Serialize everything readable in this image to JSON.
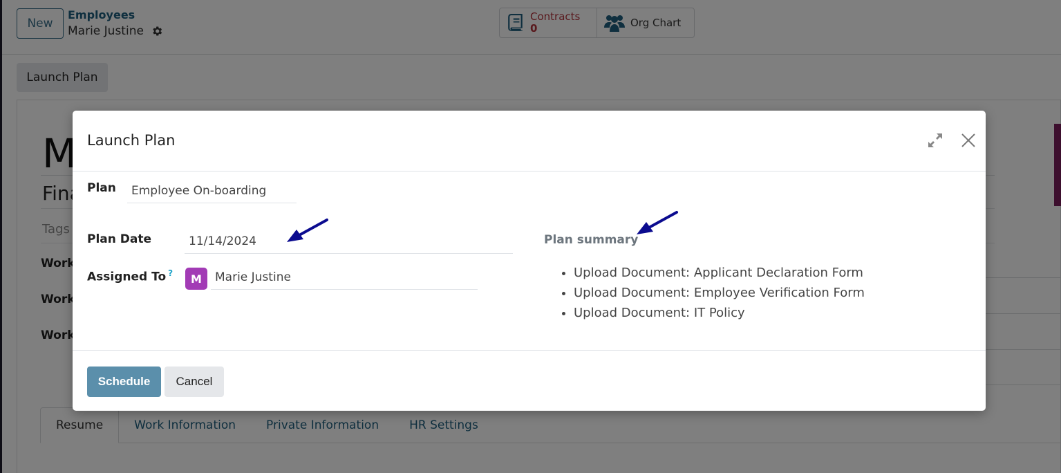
{
  "control_panel": {
    "new_label": "New",
    "breadcrumb_parent": "Employees",
    "breadcrumb_current": "Marie Justine",
    "smart_buttons": {
      "contracts_label": "Contracts",
      "contracts_count": "0",
      "org_chart_label": "Org Chart"
    },
    "launch_plan_label": "Launch Plan"
  },
  "employee_form": {
    "name_partial": "M",
    "job_partial": "Fina",
    "tags_placeholder": "Tags",
    "field_labels": [
      "Work",
      "Work",
      "Work"
    ],
    "tabs": [
      {
        "label": "Resume",
        "active": true
      },
      {
        "label": "Work Information",
        "active": false
      },
      {
        "label": "Private Information",
        "active": false
      },
      {
        "label": "HR Settings",
        "active": false
      }
    ]
  },
  "modal": {
    "title": "Launch Plan",
    "plan_label": "Plan",
    "plan_value": "Employee On-boarding",
    "plan_date_label": "Plan Date",
    "plan_date_value": "11/14/2024",
    "assigned_to_label": "Assigned To",
    "assigned_to_help": "?",
    "assigned_to_initial": "M",
    "assigned_to_value": "Marie Justine",
    "summary_title": "Plan summary",
    "summary_items": [
      "Upload Document: Applicant Declaration Form",
      "Upload Document: Employee Verification Form",
      "Upload Document: IT Policy"
    ],
    "schedule_label": "Schedule",
    "cancel_label": "Cancel"
  },
  "colors": {
    "primary": "#5b8fab",
    "contracts_red": "#b2333b",
    "avatar_purple": "#a23bb5",
    "annotation_arrow": "#0b0b8f"
  }
}
